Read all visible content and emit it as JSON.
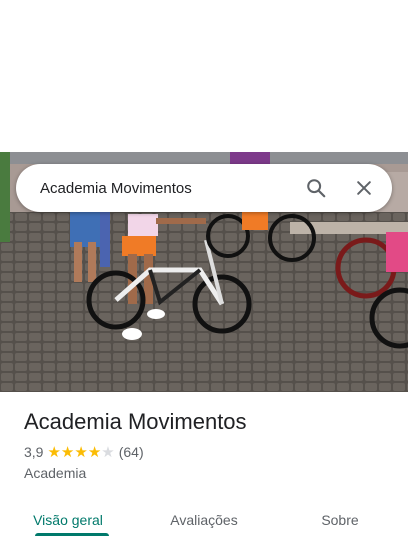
{
  "search": {
    "query": "Academia Movimentos",
    "search_icon": "search-icon",
    "close_icon": "close-icon"
  },
  "photo": {
    "description_icon": "place-photo"
  },
  "place": {
    "title": "Academia Movimentos",
    "rating": "3,9",
    "rating_fraction": 0.78,
    "review_count": "(64)",
    "category": "Academia"
  },
  "tabs": [
    {
      "label": "Visão geral",
      "active": true
    },
    {
      "label": "Avaliações",
      "active": false
    },
    {
      "label": "Sobre",
      "active": false
    }
  ],
  "colors": {
    "accent": "#00796b",
    "star": "#fbbc04",
    "star_empty": "#dadce0"
  }
}
